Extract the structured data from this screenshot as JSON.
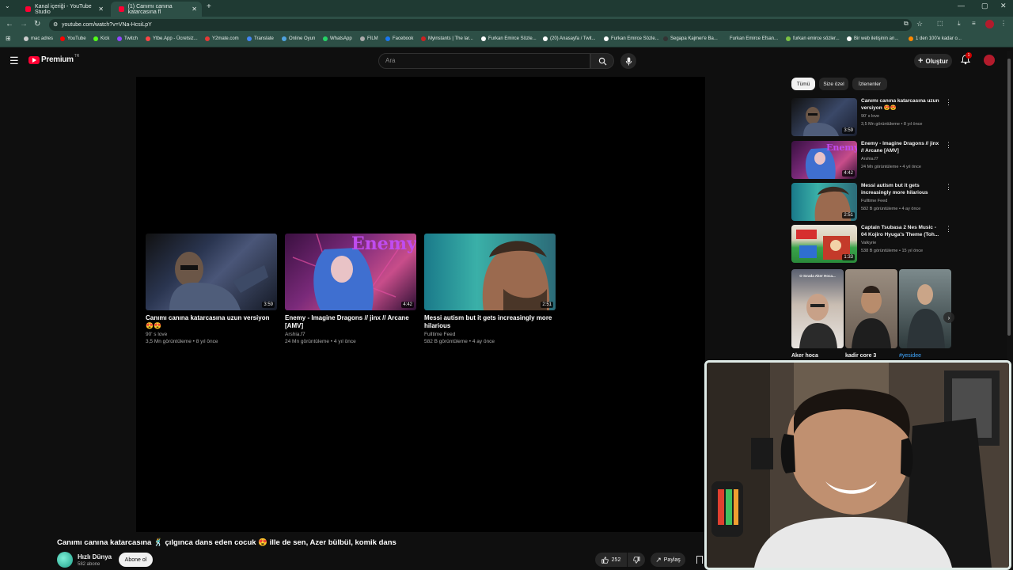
{
  "browser": {
    "tabs": [
      {
        "label": "Kanal içeriği - YouTube Studio"
      },
      {
        "label": "(1) Canımı canına katarcasına fl"
      }
    ],
    "url": "youtube.com/watch?v=VNa-HcsiLpY",
    "bookmarks": [
      {
        "label": "mac adres",
        "color": "#cccccc"
      },
      {
        "label": "YouTube",
        "color": "#ff0000"
      },
      {
        "label": "Kick",
        "color": "#53fc18"
      },
      {
        "label": "Twitch",
        "color": "#9146ff"
      },
      {
        "label": "Ytbe.App - Ücretsiz...",
        "color": "#ff4444"
      },
      {
        "label": "Y2mate.com",
        "color": "#e53935"
      },
      {
        "label": "Translate",
        "color": "#4285f4"
      },
      {
        "label": "Online Oyun",
        "color": "#4fa3e0"
      },
      {
        "label": "WhatsApp",
        "color": "#25d366"
      },
      {
        "label": "FILM",
        "color": "#aaaaaa"
      },
      {
        "label": "Facebook",
        "color": "#1877f2"
      },
      {
        "label": "Myinstants | The lar...",
        "color": "#cc2222"
      },
      {
        "label": "Furkan Emirce Sözle...",
        "color": "#ffffff"
      },
      {
        "label": "(20) Anasayfa / Twit...",
        "color": "#ffffff"
      },
      {
        "label": "Furkan Emirce Sözle...",
        "color": "#ffffff"
      },
      {
        "label": "Segapa Kajmer'e Ba...",
        "color": "#333333"
      },
      {
        "label": "Furkan Emirce Efsan...",
        "color": "#2d4f46"
      },
      {
        "label": "furkan emirce sözler...",
        "color": "#7cc242"
      },
      {
        "label": "Bir web iletişinin an...",
        "color": "#ffffff"
      },
      {
        "label": "1 den 100'e kadar o...",
        "color": "#ff8800"
      }
    ]
  },
  "youtube": {
    "logo_text": "Premium",
    "logo_badge": "TR",
    "search_placeholder": "Ara",
    "create_label": "Oluştur",
    "notification_count": "1"
  },
  "endscreen": [
    {
      "title": "Canımı canına katarcasına uzun versiyon 😍😍",
      "channel": "90' s love",
      "meta": "3,5 Mn görüntüleme • 8 yıl önce",
      "duration": "3:59"
    },
    {
      "title": "Enemy - Imagine Dragons // jinx // Arcane [AMV]",
      "channel": "Arshia.f7",
      "meta": "24 Mn görüntüleme • 4 yıl önce",
      "duration": "4:42",
      "overlay": "Enemy"
    },
    {
      "title": "Messi autism but it gets increasingly more hilarious",
      "channel": "Fulltime Feed",
      "meta": "582 B görüntüleme • 4 ay önce",
      "duration": "2:51"
    }
  ],
  "video": {
    "title": "Canımı canına katarcasına 🕺 çılgınca dans eden cocuk 😍 ille de sen, Azer bülbül, komik dans",
    "channel": "Hızlı Dünya",
    "subscribers": "582 abone",
    "subscribe_label": "Abone ol",
    "likes": "252",
    "share_label": "Paylaş"
  },
  "sidebar": {
    "chips": [
      "Tümü",
      "Size özel",
      "İzlenenler"
    ],
    "recommendations": [
      {
        "title": "Canımı canına katarcasına uzun versiyon 😍😍",
        "channel": "90' s love",
        "meta": "3,5 Mn görüntüleme • 8 yıl önce",
        "duration": "3:59"
      },
      {
        "title": "Enemy - Imagine Dragons // jinx // Arcane [AMV]",
        "channel": "Arshia.f7",
        "meta": "24 Mn görüntüleme • 4 yıl önce",
        "duration": "4:42"
      },
      {
        "title": "Messi autism but it gets increasingly more hilarious",
        "channel": "Fulltime Feed",
        "meta": "582 B görüntüleme • 4 ay önce",
        "duration": "2:51"
      },
      {
        "title": "Captain Tsubasa 2 Nes Music - 04 Kojiro Hyuga's Theme (Toh...",
        "channel": "Valkyrie",
        "meta": "538 B görüntüleme • 15 yıl önce",
        "duration": "1:33"
      }
    ],
    "shorts": [
      {
        "label": "Aker hoca",
        "overlay": "O Sırada Aker Hoca..."
      },
      {
        "label": "kadir core 3"
      },
      {
        "label": "#yesidee"
      }
    ]
  }
}
